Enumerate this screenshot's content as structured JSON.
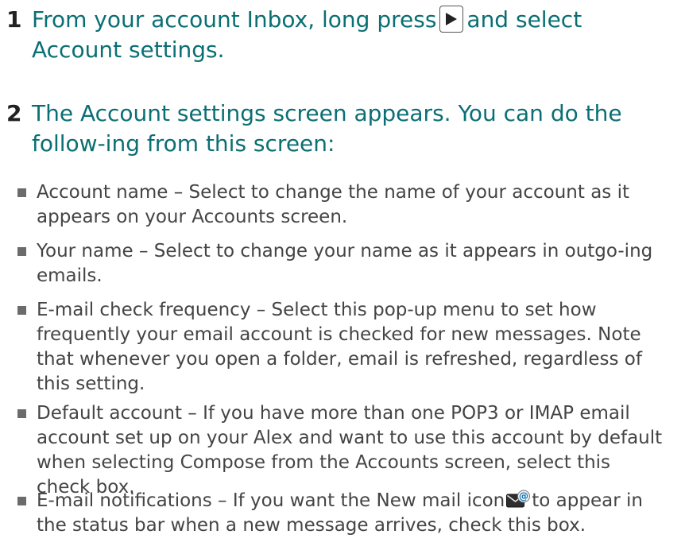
{
  "steps": [
    {
      "number": "1",
      "text_before": "From your account Inbox, long press",
      "icon": "play-arrow-icon",
      "text_after": "and select Account settings."
    },
    {
      "number": "2",
      "text": "The Account settings screen appears. You can do the follow-ing from this screen:"
    }
  ],
  "bullets": [
    {
      "text": "Account name – Select to change the name of your account as it appears on your Accounts screen."
    },
    {
      "text": "Your name – Select to change your name as it appears in outgo-ing emails."
    },
    {
      "text": "E-mail check frequency – Select this pop-up menu to set how frequently your email account is checked for new messages. Note that whenever you open a folder, email is refreshed, regardless of this setting."
    },
    {
      "text": "Default account – If you have more than one POP3 or IMAP email account set up on your Alex and want to use this account by default when selecting Compose from the Accounts screen, select this check box."
    },
    {
      "text_before": "E-mail notifications – If you want the New mail icon",
      "icon": "new-mail-icon",
      "text_after": "to appear in the status bar when a new message arrives, check this box."
    }
  ],
  "colors": {
    "heading": "#0a6f73",
    "step_number": "#222222",
    "body_text": "#444444",
    "bullet_square": "#6b6b6b"
  }
}
